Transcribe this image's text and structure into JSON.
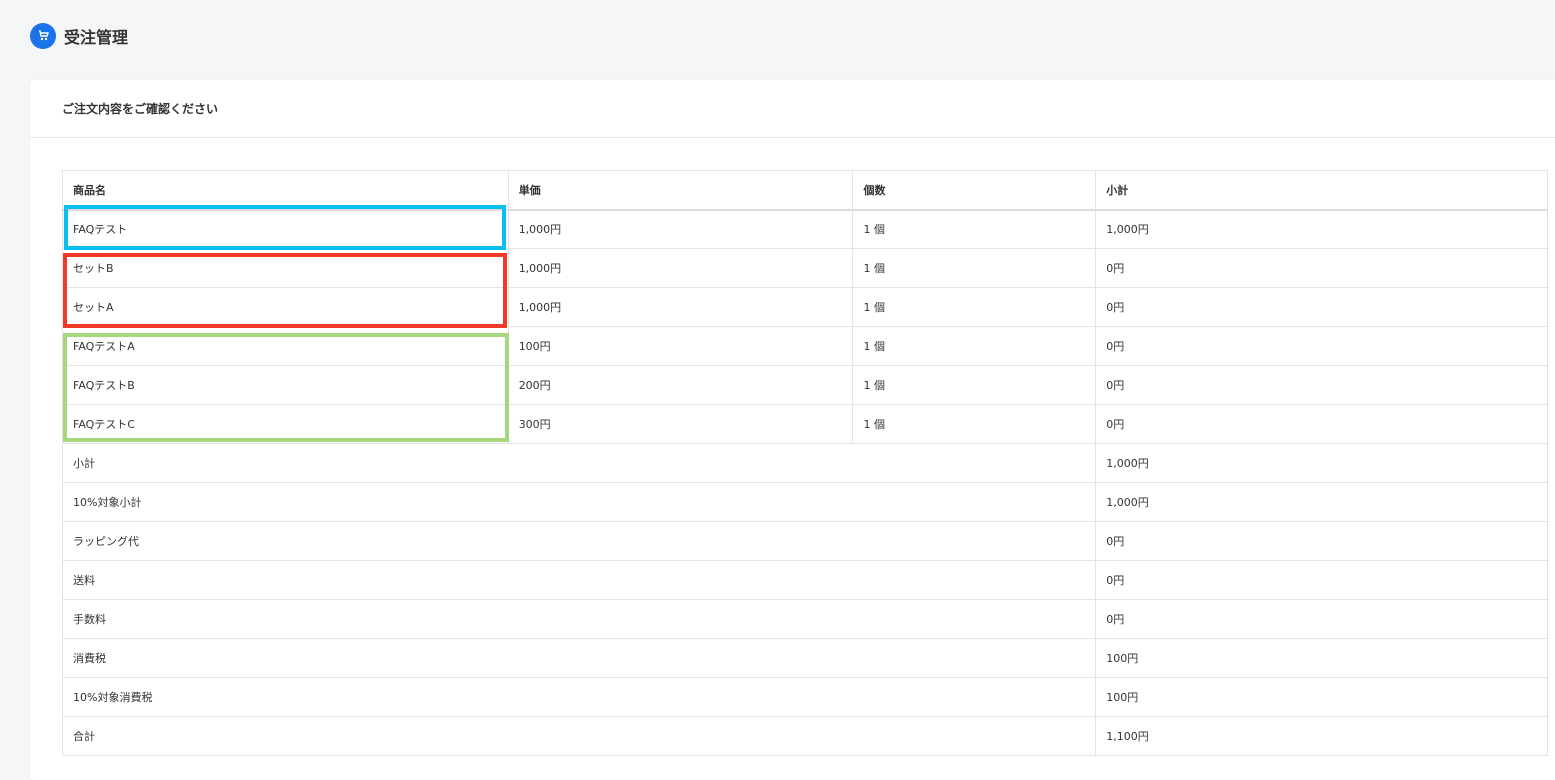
{
  "header": {
    "title": "受注管理",
    "icon": "cart-icon"
  },
  "card": {
    "title": "ご注文内容をご確認ください"
  },
  "table": {
    "columns": [
      "商品名",
      "単価",
      "個数",
      "小計"
    ],
    "rows": [
      {
        "name": "FAQテスト",
        "price": "1,000円",
        "qty": "1 個",
        "subtotal": "1,000円"
      },
      {
        "name": "セットB",
        "price": "1,000円",
        "qty": "1 個",
        "subtotal": "0円"
      },
      {
        "name": "セットA",
        "price": "1,000円",
        "qty": "1 個",
        "subtotal": "0円"
      },
      {
        "name": "FAQテストA",
        "price": "100円",
        "qty": "1 個",
        "subtotal": "0円"
      },
      {
        "name": "FAQテストB",
        "price": "200円",
        "qty": "1 個",
        "subtotal": "0円"
      },
      {
        "name": "FAQテストC",
        "price": "300円",
        "qty": "1 個",
        "subtotal": "0円"
      }
    ],
    "summary": [
      {
        "label": "小計",
        "value": "1,000円"
      },
      {
        "label": "10%対象小計",
        "value": "1,000円"
      },
      {
        "label": "ラッピング代",
        "value": "0円"
      },
      {
        "label": "送料",
        "value": "0円"
      },
      {
        "label": "手数料",
        "value": "0円"
      },
      {
        "label": "消費税",
        "value": "100円"
      },
      {
        "label": "10%対象消費税",
        "value": "100円"
      },
      {
        "label": "合計",
        "value": "1,100円"
      }
    ]
  },
  "colors": {
    "highlight_blue": "#08c0f0",
    "highlight_red": "#f13a27",
    "highlight_green": "#a6d67e",
    "total_text": "#d23f3f",
    "icon_bg": "#1a73e8"
  }
}
